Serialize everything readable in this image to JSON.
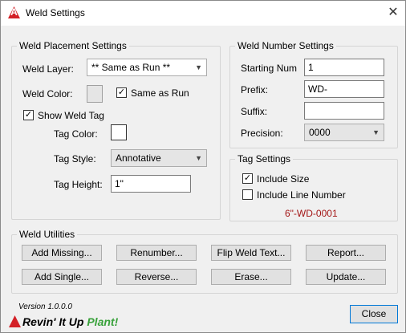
{
  "window": {
    "title": "Weld Settings"
  },
  "placement": {
    "group_label": "Weld Placement Settings",
    "weld_layer_label": "Weld Layer:",
    "weld_layer_value": "** Same as Run **",
    "weld_color_label": "Weld Color:",
    "same_as_run_label": "Same as Run",
    "same_as_run_checked": true,
    "show_weld_tag_label": "Show Weld Tag",
    "show_weld_tag_checked": true,
    "tag_color_label": "Tag Color:",
    "tag_style_label": "Tag Style:",
    "tag_style_value": "Annotative",
    "tag_height_label": "Tag Height:",
    "tag_height_value": "1\""
  },
  "number": {
    "group_label": "Weld Number Settings",
    "starting_num_label": "Starting Num",
    "starting_num_value": "1",
    "prefix_label": "Prefix:",
    "prefix_value": "WD-",
    "suffix_label": "Suffix:",
    "suffix_value": "",
    "precision_label": "Precision:",
    "precision_value": "0000"
  },
  "tag_settings": {
    "group_label": "Tag Settings",
    "include_size_label": "Include Size",
    "include_size_checked": true,
    "include_line_label": "Include Line Number",
    "include_line_checked": false,
    "example": "6\"-WD-0001"
  },
  "utilities": {
    "group_label": "Weld Utilities",
    "buttons": [
      "Add Missing...",
      "Renumber...",
      "Flip Weld Text...",
      "Report...",
      "Add Single...",
      "Reverse...",
      "Erase...",
      "Update..."
    ]
  },
  "footer": {
    "version": "Version 1.0.0.0",
    "brand_part1": "Revin' It Up ",
    "brand_part2": "Plant!",
    "close_label": "Close"
  },
  "colors": {
    "accent_border": "#0078d7",
    "example_text": "#a31515",
    "brand_green": "#38a13a"
  },
  "icons": {
    "app": "autocad-a-icon",
    "close": "close-icon",
    "dropdown": "chevron-down-icon",
    "check": "checkmark-icon"
  }
}
